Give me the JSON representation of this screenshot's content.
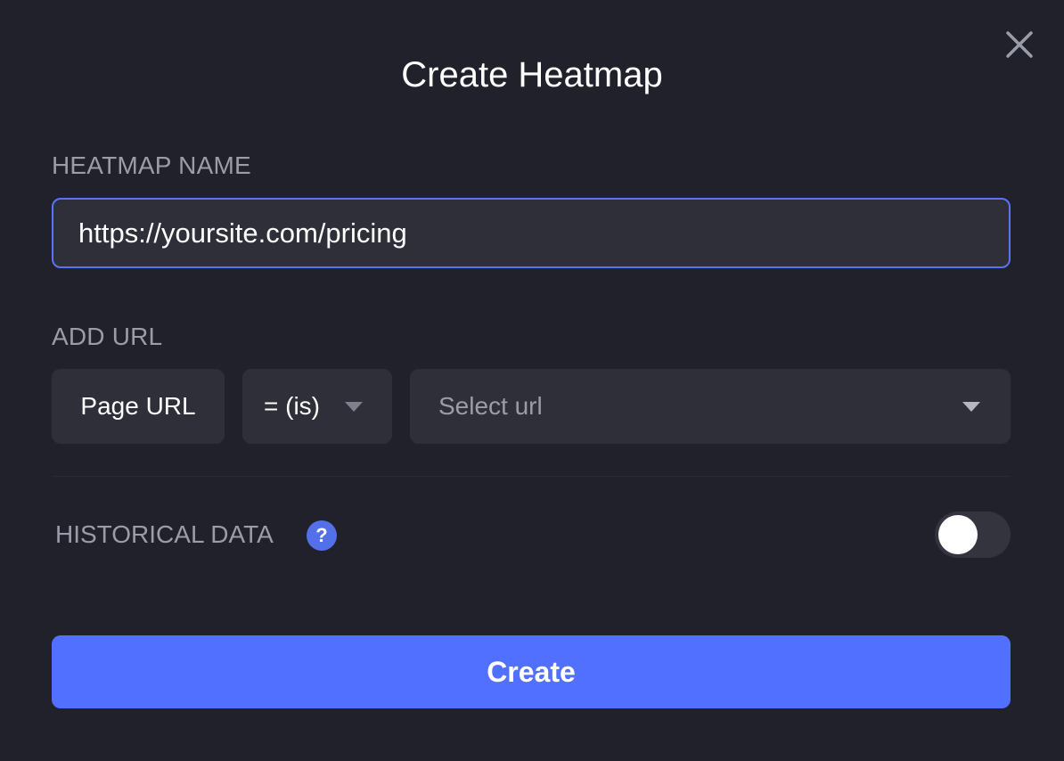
{
  "dialog": {
    "title": "Create Heatmap",
    "close_icon": "close-icon"
  },
  "heatmap_name": {
    "label": "HEATMAP NAME",
    "value": "https://yoursite.com/pricing"
  },
  "add_url": {
    "label": "ADD URL",
    "field": "Page URL",
    "operator": "= (is)",
    "url_placeholder": "Select url",
    "dropdown_icon": "caret-down-icon"
  },
  "historical_data": {
    "label": "HISTORICAL DATA",
    "help_glyph": "?",
    "help_icon": "question-icon",
    "enabled": false
  },
  "actions": {
    "create_label": "Create"
  },
  "colors": {
    "background": "#20212a",
    "field": "#2e2f39",
    "accent": "#5170ff",
    "focus_border": "#5a73f2",
    "muted_text": "#9a9ca8"
  }
}
